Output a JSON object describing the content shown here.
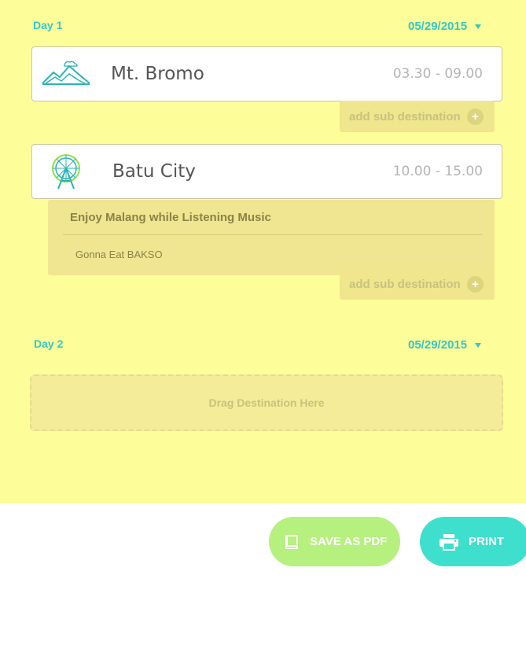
{
  "days": [
    {
      "label": "Day 1",
      "date": "05/29/2015",
      "destinations": [
        {
          "name": "Mt. Bromo",
          "time": "03.30 - 09.00",
          "icon": "mountain-icon"
        },
        {
          "name": "Batu City",
          "time": "10.00 - 15.00",
          "icon": "ferris-wheel-icon"
        }
      ],
      "sub_destination": {
        "title": "Enjoy Malang while Listening Music",
        "items": [
          "Gonna Eat BAKSO"
        ]
      }
    },
    {
      "label": "Day 2",
      "date": "05/29/2015",
      "drop_zone_text": "Drag Destination Here"
    }
  ],
  "add_sub_label": "add sub destination",
  "add_sub_plus": "+",
  "actions": {
    "save_pdf_label": "SAVE AS PDF",
    "save_pdf_icon": "book-icon",
    "print_label": "PRINT",
    "print_icon": "printer-icon"
  },
  "colors": {
    "accent": "#32c9c9",
    "background": "#fdfd9a",
    "pdf_button": "#b6f07e",
    "print_button": "#3fdfce"
  }
}
